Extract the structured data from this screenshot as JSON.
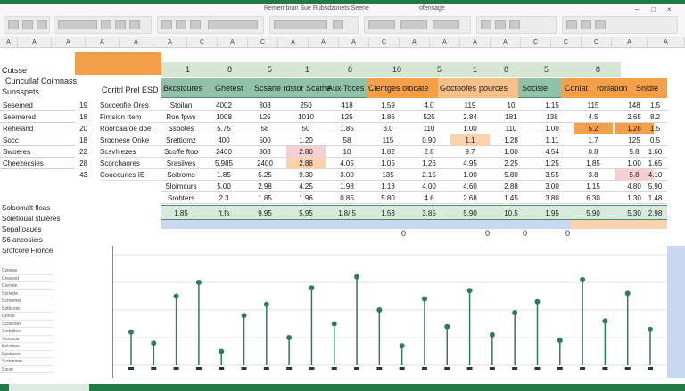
{
  "ribbon": {
    "title": "Remembran Sue Rubsdzonets Seene",
    "extra": "ofensage"
  },
  "window_controls": [
    "–",
    "□",
    "×"
  ],
  "column_headers": [
    "A",
    "A",
    "A",
    "A",
    "A",
    "A",
    "C",
    "A",
    "C",
    "A",
    "A",
    "A",
    "C",
    "A",
    "A",
    "A",
    "A",
    "C",
    "C",
    "C",
    "A",
    "A"
  ],
  "strip_numbers": [
    "1",
    "8",
    "5",
    "1",
    "8",
    "10",
    "5",
    "1",
    "8",
    "5",
    "8"
  ],
  "left_titles": {
    "top": "Cutsse",
    "sub": "Cuncullaf Coimnass",
    "section": "Sunsspets"
  },
  "left_items": [
    "Sesemed",
    "Seemered",
    "Reheland",
    "Socc",
    "Swoeres",
    "Cheezecsies"
  ],
  "left_numbers": [
    "19",
    "18",
    "20",
    "18",
    "22",
    "28",
    "43"
  ],
  "table": {
    "label": "Coritrl Prel ESD",
    "headers": [
      "Bkcstcures",
      "Ghetest",
      "Scsarie rdstor",
      "Scathe",
      "Aux Toces",
      "Cientges",
      "otocate",
      "Goctoofes",
      "pources",
      "Socisle",
      "Coniat",
      "ronlation",
      "Snidie"
    ]
  },
  "row_labels": [
    "Socceofie Ores",
    "Fimsion rtem",
    "Roorcaaroe dbe",
    "Srocnese Onke",
    "Scsvhiezes",
    "Scorchaores",
    "Couecuries IS"
  ],
  "rows": [
    [
      "Stoilan",
      "4002",
      "308",
      "250",
      "418",
      "1.59",
      "4.0",
      "119",
      "10",
      "1.15",
      "115",
      "148",
      "1.5"
    ],
    [
      "Ron fpws",
      "1008",
      "125",
      "1010",
      "125",
      "1.86",
      "525",
      "2.84",
      "181",
      "138",
      "4.5",
      "2.65",
      "8.2"
    ],
    [
      "Ssbotes",
      "5.75",
      "58",
      "50",
      "1.85",
      "3.0",
      "110",
      "1.00",
      "110",
      "1.00",
      "5.2",
      "1.28",
      "1.5"
    ],
    [
      "Srettiomz",
      "400",
      "500",
      "1.20",
      "58",
      "115",
      "0.90",
      "1.1",
      "1.28",
      "1.11",
      "1.7",
      "125",
      "0.5"
    ],
    [
      "Scoffe ftoo",
      "2400",
      "308",
      "2.86",
      "10",
      "1.82",
      "2.8",
      "9.7",
      "1.00",
      "4.54",
      "0.8",
      "5.8",
      "1.60"
    ],
    [
      "Srasiives",
      "5.985",
      "2400",
      "2.88",
      "4.05",
      "1.05",
      "1.26",
      "4.95",
      "2.25",
      "1.25",
      "1.85",
      "1.00",
      "1.65"
    ],
    [
      "Soitroms",
      "1.85",
      "5.25",
      "9.30",
      "3.00",
      "135",
      "2.15",
      "1.00",
      "5.80",
      "3.55",
      "3.8",
      "5.8",
      "4.10"
    ],
    [
      "Sloimcurs",
      "5.00",
      "2.98",
      "4.25",
      "1.98",
      "1.18",
      "4.00",
      "4.60",
      "2.88",
      "3.00",
      "1.15",
      "4.80",
      "5.90"
    ],
    [
      "Srobters",
      "2.3",
      "1.85",
      "1.96",
      "0.85",
      "5.80",
      "4.6",
      "2.68",
      "1.45",
      "3.80",
      "6.30",
      "1.30",
      "1.48"
    ]
  ],
  "totals": [
    "1.85",
    "ft.fs",
    "9.95",
    "5.95",
    "1.8/.5",
    "1.53",
    "3.85",
    "5.90",
    "10.5",
    "1.95",
    "5.90",
    "5.30",
    "2.98"
  ],
  "lower_left": [
    "Solsomalt floas",
    "Soietioual stuleres",
    "Sepaltoaues",
    "S6 ancosicrs",
    "Srofcore Fronce"
  ],
  "lower_list": [
    "Conese",
    "Creseed",
    "Cornsle",
    "Soriecle",
    "Scroemer",
    "Sotbcore",
    "Grinse",
    "Scostrses",
    "Srekolies",
    "Srocecie",
    "Solemae",
    "Spolaces",
    "Scrtoemer",
    "Socer"
  ],
  "marker_numbers": [
    "0",
    "0",
    "0",
    "0"
  ],
  "chart_data": {
    "type": "scatter",
    "series": [
      {
        "values": [
          42,
          38,
          55,
          60,
          35,
          48,
          52,
          40,
          58,
          45,
          62,
          50,
          37,
          54,
          44,
          57,
          41,
          49,
          53,
          39,
          61,
          46,
          56,
          43
        ]
      }
    ],
    "colors": {
      "marker": "#2e7d57",
      "line": "#2e7d57",
      "dark": "#333333"
    }
  },
  "colors": {
    "brand": "#1f7a45",
    "header_green": "#8fc2a8",
    "orange": "#f4a04a",
    "peach": "#f8d3ad",
    "blue": "#c9d7f0"
  }
}
